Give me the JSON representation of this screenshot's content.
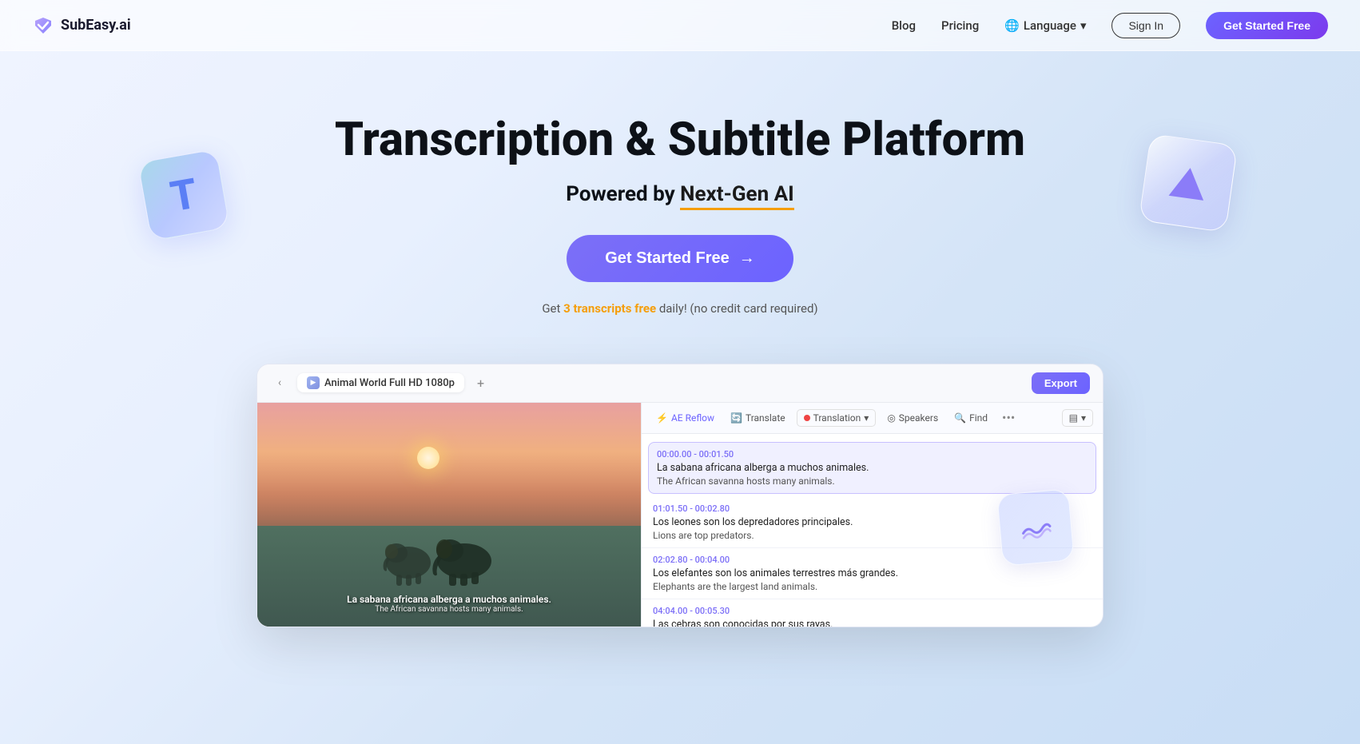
{
  "nav": {
    "logo_text": "SubEasy.ai",
    "blog_label": "Blog",
    "pricing_label": "Pricing",
    "language_label": "Language",
    "signin_label": "Sign In",
    "get_started_label": "Get Started Free"
  },
  "hero": {
    "title": "Transcription & Subtitle Platform",
    "subtitle_prefix": "Powered by ",
    "subtitle_highlight": "Next-Gen AI",
    "cta_label": "Get Started Free",
    "free_note_prefix": "Get ",
    "free_count": "3 transcripts free",
    "free_note_suffix": " daily! (no credit card required)"
  },
  "app_preview": {
    "tab_label": "Animal World Full HD 1080p",
    "export_label": "Export",
    "toolbar": {
      "reflow": "AE Reflow",
      "translate": "Translate",
      "translation": "Translation",
      "speakers": "Speakers",
      "find": "Find",
      "more": "•••"
    },
    "entries": [
      {
        "time": "00:00.00 - 00:01.50",
        "es": "La sabana africana alberga a muchos animales.",
        "en": "The African savanna hosts many animals.",
        "active": true
      },
      {
        "time": "01:01.50 - 00:02.80",
        "es": "Los leones son los depredadores principales.",
        "en": "Lions are top predators.",
        "active": false
      },
      {
        "time": "02:02.80 - 00:04.00",
        "es": "Los elefantes son los animales terrestres más grandes.",
        "en": "Elephants are the largest land animals.",
        "active": false
      },
      {
        "time": "04:04.00 - 00:05.30",
        "es": "Las cebras son conocidas por sus rayas.",
        "en": "",
        "active": false
      }
    ],
    "subtitle_es": "La sabana africana alberga a muchos animales.",
    "subtitle_en": "The African savanna hosts many animals."
  },
  "colors": {
    "brand_purple": "#6c63ff",
    "accent_orange": "#f59e0b",
    "nav_bg": "rgba(255,255,255,0.6)"
  }
}
